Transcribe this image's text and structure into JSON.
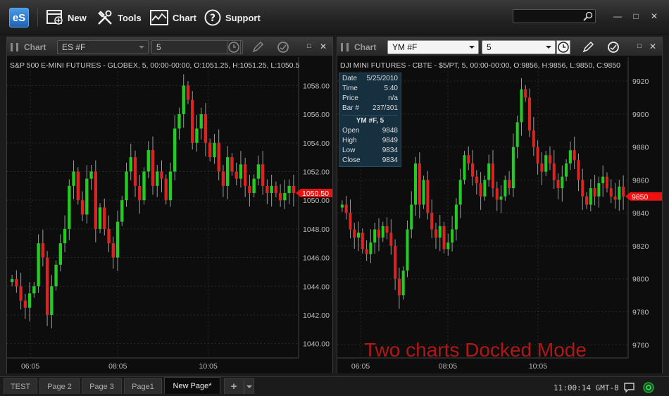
{
  "toolbar": {
    "logo": "eS",
    "new_label": "New",
    "tools_label": "Tools",
    "chart_label": "Chart",
    "support_label": "Support",
    "search_placeholder": ""
  },
  "window_controls": [
    "minimize-icon",
    "restore-icon",
    "close-icon"
  ],
  "left_chart": {
    "header_title": "Chart",
    "symbol": "ES #F",
    "interval": "5",
    "info": "S&P 500 E-MINI FUTURES - GLOBEX, 5, 00:00-00:00, O:1051.25, H:1051.25, L:1050.5",
    "price_tag": "1050.50"
  },
  "right_chart": {
    "header_title": "Chart",
    "symbol": "YM #F",
    "interval": "5",
    "info": "DJI MINI FUTURES - CBTE - $5/PT, 5, 00:00-00:00, O:9856, H:9856, L:9850, C:9850",
    "price_tag": "9850",
    "overlay_text": "Two charts Docked Mode",
    "data_box": {
      "date_label": "Date",
      "date": "5/25/2010",
      "time_label": "Time",
      "time": "5:40",
      "price_label": "Price",
      "price": "n/a",
      "bar_label": "Bar #",
      "bar": "237/301",
      "title": "YM #F, 5",
      "open_label": "Open",
      "open": "9848",
      "high_label": "High",
      "high": "9849",
      "low_label": "Low",
      "low": "9834",
      "close_label": "Close",
      "close": "9834"
    }
  },
  "chart_data": [
    {
      "type": "candlestick",
      "title": "S&P 500 E-MINI FUTURES - GLOBEX",
      "x_ticks": [
        "06:05",
        "08:05",
        "10:05"
      ],
      "y_ticks": [
        "1040.00",
        "1042.00",
        "1044.00",
        "1046.00",
        "1048.00",
        "1050.00",
        "1052.00",
        "1054.00",
        "1056.00",
        "1058.00"
      ],
      "ylim": [
        1039,
        1059
      ],
      "last": 1050.5,
      "up_color": "#22cc22",
      "down_color": "#dd2222",
      "closes": [
        1044.5,
        1044,
        1043,
        1042.5,
        1043.5,
        1044,
        1047,
        1046,
        1042,
        1044,
        1045.5,
        1047,
        1048,
        1051,
        1052,
        1050,
        1049,
        1051.5,
        1052,
        1048,
        1049.5,
        1048,
        1047,
        1046,
        1048.5,
        1050,
        1052,
        1053,
        1051,
        1050,
        1052,
        1053.5,
        1051,
        1052,
        1051.5,
        1050,
        1052,
        1055,
        1056,
        1058,
        1057,
        1054,
        1055,
        1056,
        1054,
        1053,
        1054,
        1052,
        1051,
        1053,
        1052,
        1051.5,
        1052.5,
        1051,
        1050.5,
        1051.5,
        1052.5,
        1051,
        1050.5,
        1051,
        1050.5,
        1050,
        1050.5,
        1051,
        1050.5
      ]
    },
    {
      "type": "candlestick",
      "title": "DJI MINI FUTURES - CBTE - $5/PT",
      "x_ticks": [
        "06:05",
        "08:05",
        "10:05"
      ],
      "y_ticks": [
        "9760",
        "9780",
        "9800",
        "9820",
        "9840",
        "9860",
        "9880",
        "9900",
        "9920"
      ],
      "ylim": [
        9752,
        9926
      ],
      "last": 9850,
      "up_color": "#22cc22",
      "down_color": "#dd2222",
      "closes": [
        9845,
        9840,
        9830,
        9825,
        9828,
        9818,
        9815,
        9822,
        9830,
        9825,
        9832,
        9828,
        9820,
        9800,
        9790,
        9805,
        9830,
        9845,
        9870,
        9845,
        9860,
        9840,
        9830,
        9825,
        9832,
        9818,
        9822,
        9830,
        9845,
        9860,
        9875,
        9870,
        9862,
        9858,
        9850,
        9860,
        9870,
        9855,
        9848,
        9850,
        9860,
        9855,
        9880,
        9895,
        9915,
        9910,
        9890,
        9880,
        9870,
        9865,
        9875,
        9870,
        9860,
        9855,
        9862,
        9870,
        9878,
        9872,
        9860,
        9850,
        9845,
        9855,
        9850,
        9858,
        9862,
        9855,
        9850,
        9848,
        9856,
        9850
      ]
    }
  ],
  "status": {
    "tabs": [
      "TEST",
      "Page 2",
      "Page 3",
      "Page1",
      "New Page*"
    ],
    "active_tab": "New Page*",
    "add_label": "+",
    "clock": "11:00:14 GMT-8"
  }
}
